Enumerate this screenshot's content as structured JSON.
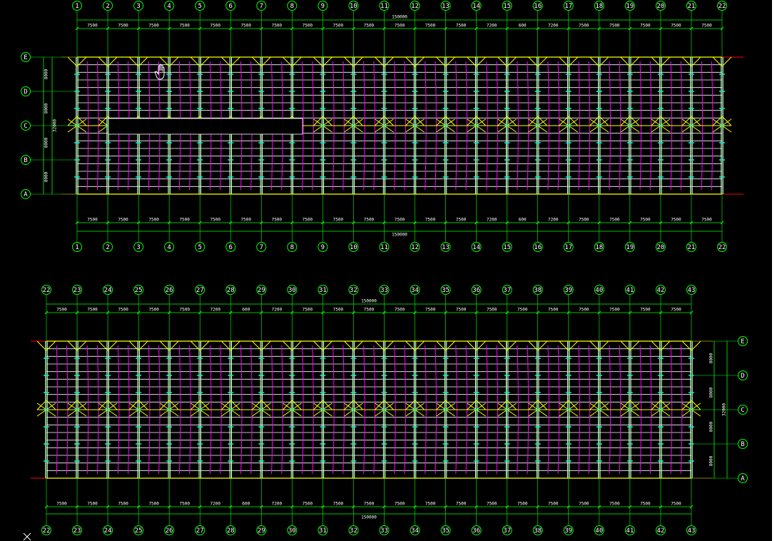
{
  "colors": {
    "background": "#000000",
    "axis": "#00ff00",
    "bracing": "#ffff00",
    "purlin": "#ff00ff",
    "member": "#ffffff",
    "marker": "#00ffff",
    "grid_end": "#ff0000"
  },
  "plan_top": {
    "columns": [
      "1",
      "2",
      "3",
      "4",
      "5",
      "6",
      "7",
      "8",
      "9",
      "10",
      "11",
      "12",
      "13",
      "14",
      "15",
      "16",
      "17",
      "18",
      "19",
      "20",
      "21",
      "22"
    ],
    "spans": [
      "7500",
      "7500",
      "7500",
      "7500",
      "7500",
      "7500",
      "7500",
      "7500",
      "7500",
      "7500",
      "7500",
      "7500",
      "7500",
      "7200",
      "600",
      "7200",
      "7500",
      "7500",
      "7500",
      "7500",
      "7500"
    ],
    "total": "150000",
    "rows": [
      "E",
      "D",
      "C",
      "B",
      "A"
    ],
    "row_spans": [
      "8000",
      "8000",
      "8000",
      "8000"
    ],
    "row_total": "32000"
  },
  "plan_bottom": {
    "columns": [
      "22",
      "23",
      "24",
      "25",
      "26",
      "27",
      "28",
      "29",
      "30",
      "31",
      "32",
      "33",
      "34",
      "35",
      "36",
      "37",
      "38",
      "39",
      "40",
      "41",
      "42",
      "43"
    ],
    "spans": [
      "7500",
      "7500",
      "7500",
      "7500",
      "7500",
      "7200",
      "600",
      "7200",
      "7500",
      "7500",
      "7500",
      "7500",
      "7500",
      "7500",
      "7500",
      "7500",
      "7500",
      "7500",
      "7500",
      "7500",
      "7500"
    ],
    "total": "150000",
    "rows": [
      "E",
      "D",
      "C",
      "B",
      "A"
    ],
    "row_spans": [
      "8000",
      "8000",
      "8000",
      "8000"
    ],
    "row_total": "32000"
  },
  "cursor": "hand-cursor-icon",
  "corner_icon": "ucs-x-icon"
}
